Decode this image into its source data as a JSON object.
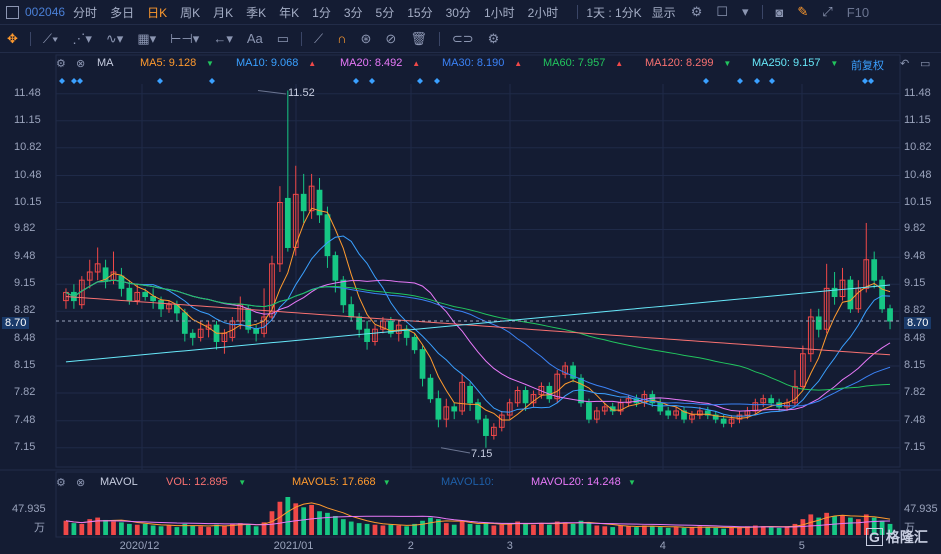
{
  "topbar": {
    "code": "002046",
    "periods": [
      "分时",
      "多日",
      "日K",
      "周K",
      "月K",
      "季K",
      "年K",
      "1分",
      "3分",
      "5分",
      "15分",
      "30分",
      "1小时",
      "2小时"
    ],
    "active_period": "日K",
    "dropdown": "1天 : 1分K",
    "display": "显示",
    "f10": "F10"
  },
  "legend": {
    "ma_label": "MA",
    "items": [
      {
        "text": "MA5: 9.128",
        "color": "#ff9a2e",
        "dir": "down"
      },
      {
        "text": "MA10: 9.068",
        "color": "#3aa0ff",
        "dir": "up"
      },
      {
        "text": "MA20: 8.492",
        "color": "#e879f9",
        "dir": "up"
      },
      {
        "text": "MA30: 8.190",
        "color": "#3b82f6",
        "dir": "up"
      },
      {
        "text": "MA60: 7.957",
        "color": "#22c55e",
        "dir": "up"
      },
      {
        "text": "MA120: 8.299",
        "color": "#f87171",
        "dir": "down"
      },
      {
        "text": "MA250: 9.157",
        "color": "#67e8f9",
        "dir": "down"
      }
    ],
    "adjust": "前复权"
  },
  "vol_legend": {
    "label": "MAVOL",
    "items": [
      {
        "text": "VOL: 12.895",
        "color": "#f87171",
        "dir": "down"
      },
      {
        "text": "MAVOL5: 17.668",
        "color": "#ff9a2e",
        "dir": "down"
      },
      {
        "text": "MAVOL10:",
        "color": "#1e5fa8",
        "dir": ""
      },
      {
        "text": "MAVOL20: 14.248",
        "color": "#e879f9",
        "dir": "down"
      }
    ]
  },
  "y_axis": [
    "11.48",
    "11.15",
    "10.82",
    "10.48",
    "10.15",
    "9.82",
    "9.48",
    "9.15",
    "8.82",
    "8.48",
    "8.15",
    "7.82",
    "7.48",
    "7.15"
  ],
  "current_price": "8.70",
  "high_label": "11.52",
  "low_label": "7.15",
  "vol_axis": {
    "top": "47.935",
    "unit": "万"
  },
  "x_labels": [
    "2020/12",
    "2021/01",
    "2",
    "3",
    "4",
    "5"
  ],
  "watermark": "格隆汇",
  "chart_data": {
    "type": "candlestick",
    "candles": [
      [
        8.95,
        9.05,
        8.85,
        9.1
      ],
      [
        9.05,
        8.95,
        8.85,
        9.15
      ],
      [
        8.9,
        9.2,
        8.85,
        9.25
      ],
      [
        9.2,
        9.3,
        9.1,
        9.45
      ],
      [
        9.3,
        9.4,
        9.2,
        9.6
      ],
      [
        9.35,
        9.2,
        9.1,
        9.45
      ],
      [
        9.2,
        9.3,
        9.15,
        9.55
      ],
      [
        9.25,
        9.1,
        9.0,
        9.35
      ],
      [
        9.1,
        8.95,
        8.9,
        9.2
      ],
      [
        8.95,
        9.05,
        8.9,
        9.15
      ],
      [
        9.05,
        9.0,
        8.95,
        9.1
      ],
      [
        9.0,
        8.95,
        8.85,
        9.1
      ],
      [
        8.95,
        8.85,
        8.75,
        9.0
      ],
      [
        8.85,
        8.9,
        8.8,
        8.95
      ],
      [
        8.9,
        8.8,
        8.7,
        8.95
      ],
      [
        8.8,
        8.55,
        8.45,
        8.85
      ],
      [
        8.55,
        8.5,
        8.4,
        8.6
      ],
      [
        8.5,
        8.6,
        8.45,
        8.7
      ],
      [
        8.6,
        8.65,
        8.5,
        8.7
      ],
      [
        8.65,
        8.45,
        8.35,
        8.7
      ],
      [
        8.45,
        8.55,
        8.3,
        8.6
      ],
      [
        8.5,
        8.7,
        8.45,
        8.75
      ],
      [
        8.7,
        8.9,
        8.6,
        9.0
      ],
      [
        8.85,
        8.6,
        8.55,
        8.9
      ],
      [
        8.6,
        8.55,
        8.45,
        8.65
      ],
      [
        8.55,
        8.75,
        8.5,
        9.1
      ],
      [
        8.75,
        9.4,
        8.7,
        9.5
      ],
      [
        9.4,
        10.15,
        9.3,
        10.35
      ],
      [
        10.2,
        9.6,
        9.55,
        11.52
      ],
      [
        9.6,
        10.25,
        9.5,
        10.6
      ],
      [
        10.25,
        10.05,
        9.9,
        10.5
      ],
      [
        10.05,
        10.35,
        9.95,
        10.5
      ],
      [
        10.3,
        10.0,
        9.9,
        10.45
      ],
      [
        10.0,
        9.5,
        9.35,
        10.1
      ],
      [
        9.5,
        9.2,
        9.05,
        9.55
      ],
      [
        9.2,
        8.9,
        8.8,
        9.25
      ],
      [
        8.9,
        8.75,
        8.7,
        9.0
      ],
      [
        8.75,
        8.6,
        8.5,
        8.8
      ],
      [
        8.6,
        8.45,
        8.35,
        8.7
      ],
      [
        8.45,
        8.6,
        8.4,
        8.65
      ],
      [
        8.6,
        8.7,
        8.55,
        8.75
      ],
      [
        8.7,
        8.55,
        8.5,
        8.75
      ],
      [
        8.55,
        8.65,
        8.45,
        8.7
      ],
      [
        8.6,
        8.5,
        8.4,
        8.65
      ],
      [
        8.5,
        8.35,
        8.3,
        8.55
      ],
      [
        8.35,
        8.0,
        7.9,
        8.4
      ],
      [
        8.0,
        7.75,
        7.7,
        8.05
      ],
      [
        7.75,
        7.5,
        7.4,
        7.85
      ],
      [
        7.5,
        7.65,
        7.4,
        7.75
      ],
      [
        7.65,
        7.6,
        7.5,
        7.7
      ],
      [
        7.6,
        7.95,
        7.55,
        8.05
      ],
      [
        7.9,
        7.7,
        7.6,
        7.95
      ],
      [
        7.7,
        7.5,
        7.45,
        7.75
      ],
      [
        7.5,
        7.3,
        7.15,
        7.55
      ],
      [
        7.3,
        7.4,
        7.25,
        7.45
      ],
      [
        7.4,
        7.55,
        7.35,
        7.6
      ],
      [
        7.55,
        7.7,
        7.5,
        7.75
      ],
      [
        7.7,
        7.85,
        7.65,
        7.9
      ],
      [
        7.85,
        7.7,
        7.6,
        7.9
      ],
      [
        7.7,
        7.8,
        7.65,
        7.85
      ],
      [
        7.8,
        7.9,
        7.75,
        7.95
      ],
      [
        7.9,
        7.75,
        7.7,
        7.95
      ],
      [
        7.75,
        8.05,
        7.7,
        8.1
      ],
      [
        8.05,
        8.15,
        8.0,
        8.2
      ],
      [
        8.15,
        8.0,
        7.95,
        8.2
      ],
      [
        8.0,
        7.7,
        7.65,
        8.05
      ],
      [
        7.7,
        7.5,
        7.45,
        7.75
      ],
      [
        7.5,
        7.6,
        7.45,
        7.65
      ],
      [
        7.6,
        7.65,
        7.55,
        7.7
      ],
      [
        7.65,
        7.6,
        7.55,
        7.7
      ],
      [
        7.6,
        7.7,
        7.55,
        7.75
      ],
      [
        7.7,
        7.75,
        7.65,
        7.8
      ],
      [
        7.75,
        7.7,
        7.65,
        7.8
      ],
      [
        7.7,
        7.8,
        7.65,
        7.85
      ],
      [
        7.8,
        7.7,
        7.65,
        7.85
      ],
      [
        7.7,
        7.6,
        7.55,
        7.75
      ],
      [
        7.6,
        7.55,
        7.5,
        7.65
      ],
      [
        7.55,
        7.6,
        7.5,
        7.65
      ],
      [
        7.6,
        7.5,
        7.45,
        7.65
      ],
      [
        7.5,
        7.55,
        7.45,
        7.6
      ],
      [
        7.55,
        7.6,
        7.5,
        7.65
      ],
      [
        7.6,
        7.55,
        7.5,
        7.65
      ],
      [
        7.55,
        7.5,
        7.45,
        7.6
      ],
      [
        7.5,
        7.45,
        7.4,
        7.55
      ],
      [
        7.45,
        7.5,
        7.4,
        7.55
      ],
      [
        7.5,
        7.55,
        7.45,
        7.6
      ],
      [
        7.55,
        7.6,
        7.5,
        7.65
      ],
      [
        7.6,
        7.7,
        7.55,
        7.75
      ],
      [
        7.7,
        7.75,
        7.65,
        7.8
      ],
      [
        7.75,
        7.7,
        7.65,
        7.8
      ],
      [
        7.7,
        7.65,
        7.6,
        7.75
      ],
      [
        7.65,
        7.7,
        7.6,
        7.75
      ],
      [
        7.7,
        7.9,
        7.65,
        8.1
      ],
      [
        7.9,
        8.3,
        7.85,
        8.4
      ],
      [
        8.3,
        8.75,
        8.2,
        8.85
      ],
      [
        8.75,
        8.6,
        8.5,
        8.85
      ],
      [
        8.6,
        9.1,
        8.55,
        9.4
      ],
      [
        9.1,
        9.0,
        8.9,
        9.3
      ],
      [
        9.0,
        9.2,
        8.95,
        9.35
      ],
      [
        9.2,
        8.85,
        8.8,
        9.25
      ],
      [
        8.85,
        9.1,
        8.8,
        9.2
      ],
      [
        9.1,
        9.45,
        9.05,
        9.9
      ],
      [
        9.45,
        9.2,
        9.1,
        9.55
      ],
      [
        9.2,
        8.85,
        8.8,
        9.25
      ],
      [
        8.85,
        8.7,
        8.6,
        8.9
      ]
    ],
    "volumes": [
      18,
      15,
      14,
      20,
      22,
      19,
      17,
      16,
      14,
      13,
      14,
      12,
      11,
      12,
      10,
      14,
      12,
      11,
      10,
      13,
      12,
      14,
      15,
      13,
      11,
      16,
      30,
      42,
      48,
      40,
      35,
      38,
      30,
      28,
      24,
      20,
      17,
      15,
      14,
      13,
      12,
      13,
      12,
      11,
      14,
      18,
      22,
      20,
      15,
      13,
      18,
      14,
      13,
      16,
      12,
      13,
      15,
      17,
      14,
      13,
      15,
      13,
      17,
      16,
      14,
      18,
      15,
      12,
      11,
      10,
      12,
      11,
      10,
      12,
      11,
      10,
      9,
      10,
      9,
      10,
      11,
      10,
      9,
      8,
      9,
      10,
      11,
      12,
      11,
      10,
      9,
      11,
      14,
      20,
      26,
      22,
      28,
      24,
      25,
      22,
      20,
      26,
      22,
      18,
      14
    ],
    "ylim": [
      7.0,
      11.6
    ]
  }
}
